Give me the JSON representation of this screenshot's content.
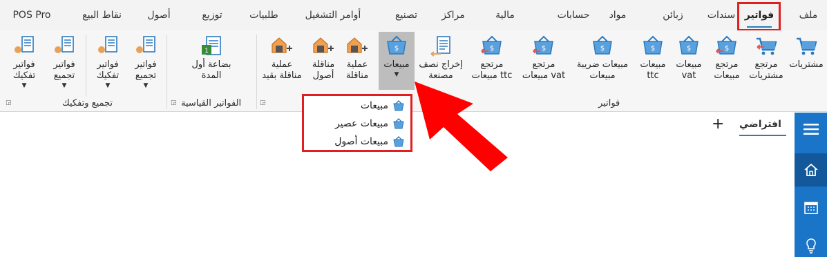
{
  "menu": {
    "tabs": [
      {
        "id": "file",
        "label": "ملف"
      },
      {
        "id": "invoices",
        "label": "فواتير",
        "active": true
      },
      {
        "id": "bonds",
        "label": "سندات"
      },
      {
        "id": "customers",
        "label": "زبائن"
      },
      {
        "id": "materials",
        "label": "مواد"
      },
      {
        "id": "accounts",
        "label": "حسابات"
      },
      {
        "id": "finance",
        "label": "مالية"
      },
      {
        "id": "centers",
        "label": "مراكز"
      },
      {
        "id": "manufacture",
        "label": "تصنيع"
      },
      {
        "id": "operation_orders",
        "label": "أوامر التشغيل"
      },
      {
        "id": "requests",
        "label": "طلبيات"
      },
      {
        "id": "distribution",
        "label": "توزيع"
      },
      {
        "id": "assets",
        "label": "أصول"
      },
      {
        "id": "pos",
        "label": "نقاط البيع"
      },
      {
        "id": "pos_pro",
        "label": "POS Pro"
      }
    ]
  },
  "ribbon": {
    "groups": {
      "invoices": "فواتير",
      "standard": "الفواتير القياسية",
      "assembly": "تجميع وتفكيك"
    },
    "buttons": {
      "purchases": "مشتريات",
      "purchase_return": "مرتجع\nمشتريات",
      "sales_return": "مرتجع\nمبيعات",
      "sales_vat": "مبيعات\nvat",
      "sales_ttc": "مبيعات\nttc",
      "tax_sales": "مبيعات ضريبة\nمبيعات",
      "return_vat": "مرتجع\nمبيعات vat",
      "return_ttc": "مرتجع\nمبيعات ttc",
      "semi_output": "إخراج نصف\nمصنعة",
      "sales": "مبيعات",
      "transfer_op": "عملية\nمناقلة",
      "transfer_assets": "مناقلة\nأصول",
      "transfer_entry": "عملية\nمناقلة بقيد",
      "first_period": "بضاعة أول\nالمدة",
      "assembly_inv_1": "فواتير\nتجميع",
      "disassembly_inv_1": "فواتير\nتفكيك",
      "assembly_inv_2": "فواتير\nتجميع",
      "disassembly_inv_2": "فواتير\nتفكيك"
    }
  },
  "sales_dropdown": {
    "items": [
      "مبيعات",
      "مبيعات عصير",
      "مبيعات أصول"
    ]
  },
  "content": {
    "tab_label": "افتراضي",
    "add_label": "+"
  },
  "colors": {
    "accent": "#2b7bc0",
    "highlight": "#e02020",
    "sidebar": "#1a74c7"
  }
}
